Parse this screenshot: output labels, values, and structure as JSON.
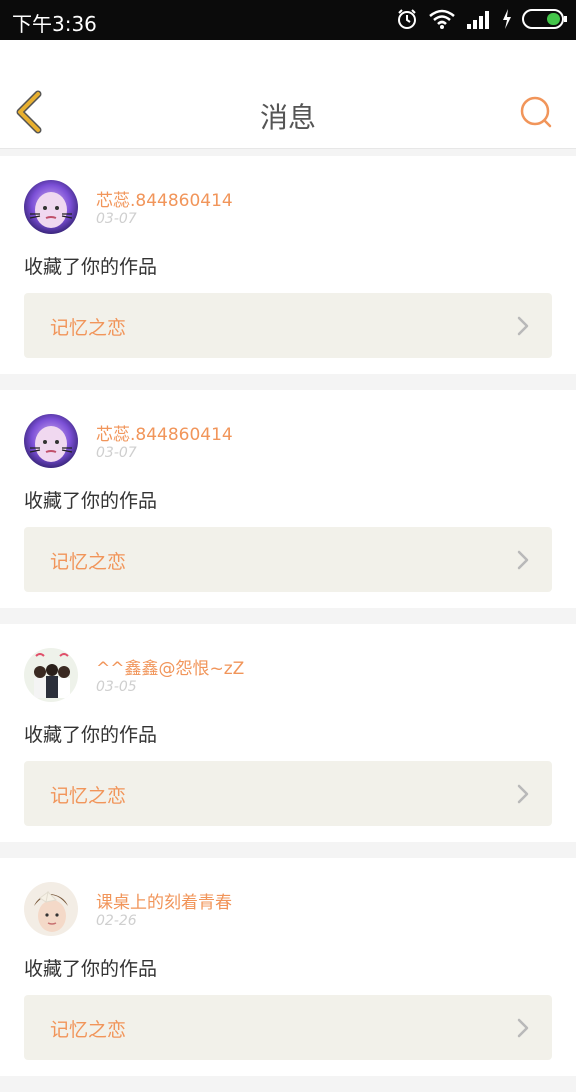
{
  "status_bar": {
    "time": "下午3:36"
  },
  "header": {
    "title": "消息"
  },
  "messages": [
    {
      "username": "芯蕊.844860414",
      "date": "03-07",
      "action": "收藏了你的作品",
      "work_title": "记忆之恋"
    },
    {
      "username": "芯蕊.844860414",
      "date": "03-07",
      "action": "收藏了你的作品",
      "work_title": "记忆之恋"
    },
    {
      "username": "^^鑫鑫@怨恨~zZ",
      "date": "03-05",
      "action": "收藏了你的作品",
      "work_title": "记忆之恋"
    },
    {
      "username": "课桌上的刻着青春",
      "date": "02-26",
      "action": "收藏了你的作品",
      "work_title": "记忆之恋"
    }
  ],
  "colors": {
    "accent": "#f1955a",
    "header_back": "#e8b030",
    "card_link_bg": "#f2f1ea"
  },
  "icons": {
    "back": "chevron-left-icon",
    "search": "search-icon",
    "link": "chevron-right-icon",
    "status": [
      "alarm-icon",
      "wifi-icon",
      "signal-icon",
      "charging-icon",
      "battery-icon"
    ]
  }
}
